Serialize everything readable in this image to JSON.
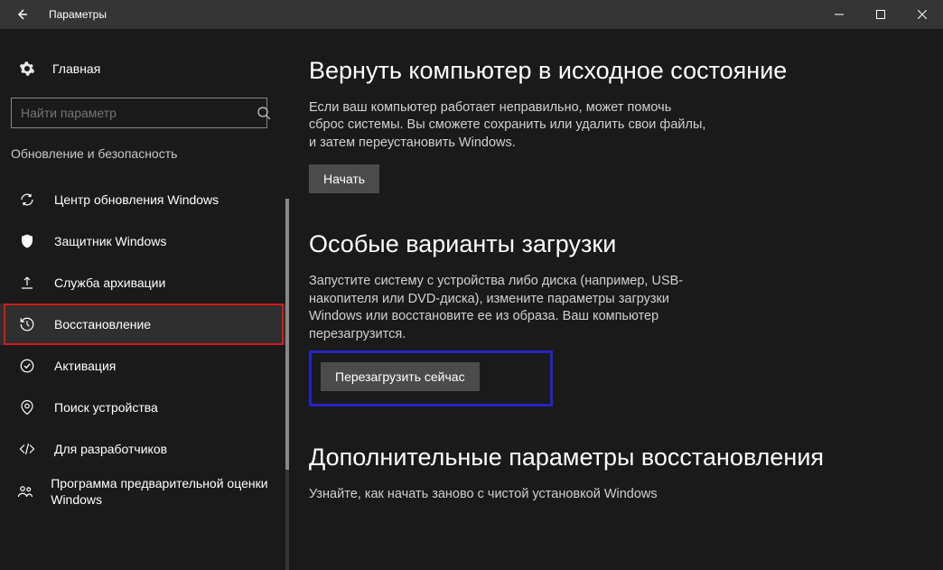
{
  "window": {
    "title": "Параметры"
  },
  "sidebar": {
    "home": "Главная",
    "search_placeholder": "Найти параметр",
    "category": "Обновление и безопасность",
    "items": [
      {
        "label": "Центр обновления Windows"
      },
      {
        "label": "Защитник Windows"
      },
      {
        "label": "Служба архивации"
      },
      {
        "label": "Восстановление"
      },
      {
        "label": "Активация"
      },
      {
        "label": "Поиск устройства"
      },
      {
        "label": "Для разработчиков"
      },
      {
        "label": "Программа предварительной оценки Windows"
      }
    ]
  },
  "content": {
    "reset": {
      "heading": "Вернуть компьютер в исходное состояние",
      "body": "Если ваш компьютер работает неправильно, может помочь сброс системы. Вы сможете сохранить или удалить свои файлы, и затем переустановить Windows.",
      "button": "Начать"
    },
    "advstart": {
      "heading": "Особые варианты загрузки",
      "body": "Запустите систему с устройства либо диска (например, USB-накопителя или DVD-диска), измените параметры загрузки Windows или восстановите ее из образа. Ваш компьютер перезагрузится.",
      "button": "Перезагрузить сейчас"
    },
    "more": {
      "heading": "Дополнительные параметры восстановления",
      "body": "Узнайте, как начать заново с чистой установкой Windows"
    }
  }
}
